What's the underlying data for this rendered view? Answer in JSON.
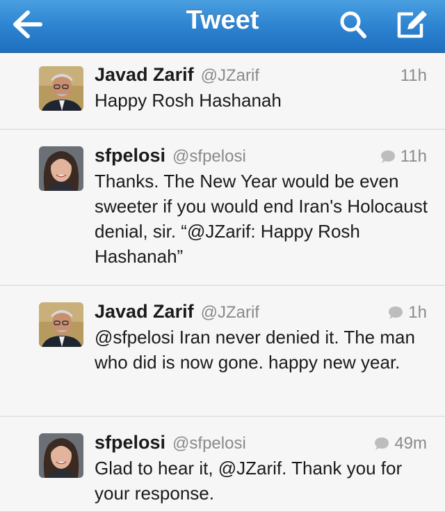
{
  "nav": {
    "title": "Tweet",
    "back_icon": "back-arrow-icon",
    "search_icon": "search-icon",
    "compose_icon": "compose-icon"
  },
  "colors": {
    "nav_bar": "#2f86d2",
    "background": "#f6f6f6",
    "muted_text": "#8a8a8a"
  },
  "tweets": [
    {
      "name": "Javad Zarif",
      "handle": "@JZarif",
      "time": "11h",
      "reply_icon": false,
      "text": "Happy Rosh Hashanah"
    },
    {
      "name": "sfpelosi",
      "handle": "@sfpelosi",
      "time": "11h",
      "reply_icon": true,
      "text": "Thanks. The New Year would be even sweeter if you would end Iran's Holocaust denial, sir. “@JZarif: Happy Rosh Hashanah”"
    },
    {
      "name": "Javad Zarif",
      "handle": "@JZarif",
      "time": "1h",
      "reply_icon": true,
      "text": "@sfpelosi Iran never denied it.  The man who did is now gone.  happy new year."
    },
    {
      "name": "sfpelosi",
      "handle": "@sfpelosi",
      "time": "49m",
      "reply_icon": true,
      "text": "Glad to hear it, @JZarif. Thank you for your response."
    }
  ]
}
